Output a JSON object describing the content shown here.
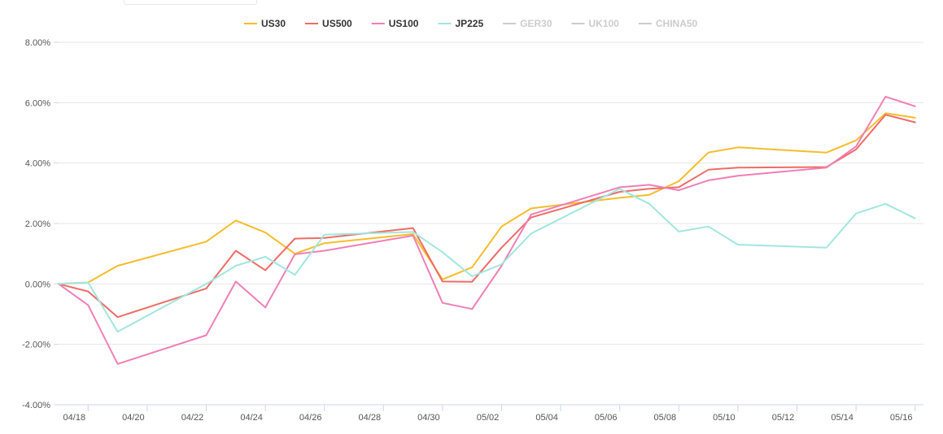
{
  "chart_data": {
    "type": "line",
    "x": [
      "04/17",
      "04/18",
      "04/19",
      "04/22",
      "04/23",
      "04/24",
      "04/25",
      "04/26",
      "04/29",
      "04/30",
      "05/01",
      "05/02",
      "05/03",
      "05/06",
      "05/07",
      "05/08",
      "05/09",
      "05/10",
      "05/13",
      "05/14",
      "05/15",
      "05/16"
    ],
    "series": [
      {
        "name": "US30",
        "color": "#f5bd2b",
        "visible": true,
        "values": [
          0.0,
          0.05,
          0.6,
          1.4,
          2.1,
          1.7,
          1.0,
          1.35,
          1.65,
          0.15,
          0.55,
          1.9,
          2.5,
          2.85,
          2.95,
          3.4,
          4.35,
          4.52,
          4.35,
          4.75,
          5.65,
          5.5
        ]
      },
      {
        "name": "US500",
        "color": "#ee6c66",
        "visible": true,
        "values": [
          0.0,
          -0.25,
          -1.1,
          -0.15,
          1.1,
          0.45,
          1.5,
          1.52,
          1.85,
          0.08,
          0.07,
          1.2,
          2.2,
          3.05,
          3.15,
          3.2,
          3.78,
          3.85,
          3.87,
          4.45,
          5.6,
          5.35
        ]
      },
      {
        "name": "US100",
        "color": "#f07fb5",
        "visible": true,
        "values": [
          0.0,
          -0.7,
          -2.65,
          -1.7,
          0.08,
          -0.78,
          0.98,
          1.1,
          1.6,
          -0.63,
          -0.83,
          0.6,
          2.3,
          3.2,
          3.28,
          3.1,
          3.43,
          3.58,
          3.85,
          4.55,
          6.2,
          5.88
        ]
      },
      {
        "name": "JP225",
        "color": "#a1e6de",
        "visible": true,
        "values": [
          0.0,
          0.05,
          -1.58,
          0.0,
          0.6,
          0.9,
          0.3,
          1.63,
          1.72,
          1.05,
          0.25,
          0.65,
          1.67,
          3.15,
          2.65,
          1.73,
          1.9,
          1.3,
          1.2,
          2.33,
          2.65,
          2.17
        ]
      },
      {
        "name": "GER30",
        "color": "#cccccc",
        "visible": false,
        "values": []
      },
      {
        "name": "UK100",
        "color": "#cccccc",
        "visible": false,
        "values": []
      },
      {
        "name": "CHINA50",
        "color": "#cccccc",
        "visible": false,
        "values": []
      }
    ],
    "x_ticks": [
      "04/18",
      "04/20",
      "04/22",
      "04/24",
      "04/26",
      "04/28",
      "04/30",
      "05/02",
      "05/04",
      "05/06",
      "05/08",
      "05/10",
      "05/12",
      "05/14",
      "05/16"
    ],
    "y_ticks": [
      "8.00%",
      "6.00%",
      "4.00%",
      "2.00%",
      "0.00%",
      "-2.00%",
      "-4.00%"
    ],
    "ylim": [
      -4,
      8
    ],
    "y_unit": "%",
    "title": "",
    "xlabel": "",
    "ylabel": "",
    "grid": "horizontal",
    "legend_position": "top-center"
  }
}
